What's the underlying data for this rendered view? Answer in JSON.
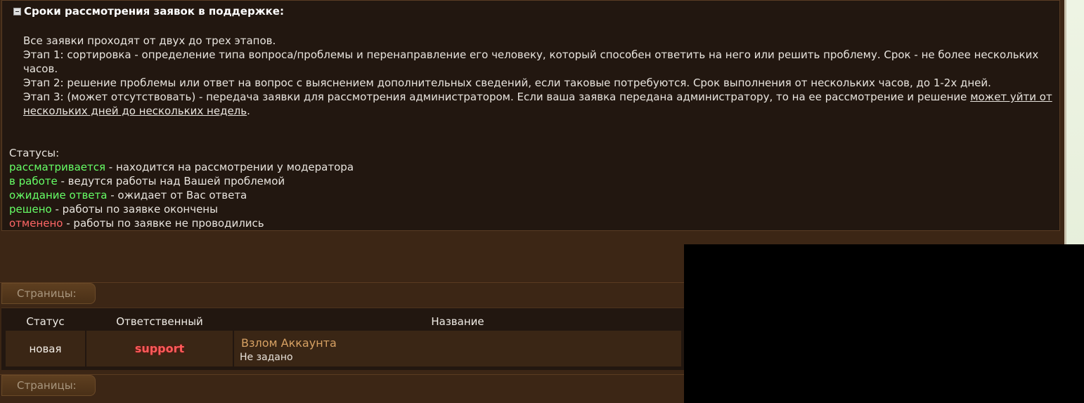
{
  "info": {
    "title": "Сроки рассмотрения заявок в поддержке:",
    "intro": "Все заявки проходят от двух до трех этапов.",
    "stage1": "Этап 1: сортировка - определение типа вопроса/проблемы и перенаправление его человеку, который способен ответить на него или решить проблему. Срок - не более нескольких часов.",
    "stage2": "Этап 2: решение проблемы или ответ на вопрос с выяснением дополнительных сведений, если таковые потребуются. Срок выполнения от нескольких часов, до 1-2х дней.",
    "stage3_main": "Этап 3: (может отсутствовать) - передача заявки для рассмотрения администратором. Если ваша заявка передана администратору, то на ее рассмотрение и решение ",
    "stage3_underline": "может уйти от нескольких дней до нескольких недель",
    "stage3_end": "."
  },
  "statuses": {
    "heading": "Статусы:",
    "items": [
      {
        "name": "рассматривается",
        "desc": " - находится на рассмотрении у модератора",
        "color": "#66ff66"
      },
      {
        "name": "в работе",
        "desc": " - ведутся работы над Вашей проблемой",
        "color": "#66ff66"
      },
      {
        "name": "ожидание ответа",
        "desc": " - ожидает от Вас ответа",
        "color": "#66ff66"
      },
      {
        "name": "решено",
        "desc": " - работы по заявке окончены",
        "color": "#66ff66"
      },
      {
        "name": "отменено",
        "desc": " - работы по заявке не проводились",
        "color": "#ff6666"
      }
    ]
  },
  "pagination": {
    "label": "Страницы:"
  },
  "table": {
    "headers": {
      "status": "Статус",
      "responsible": "Ответственный",
      "name": "Название"
    },
    "rows": [
      {
        "status": "новая",
        "responsible": "support",
        "title": "Взлом Аккаунта",
        "subtitle": "Не задано"
      }
    ]
  }
}
